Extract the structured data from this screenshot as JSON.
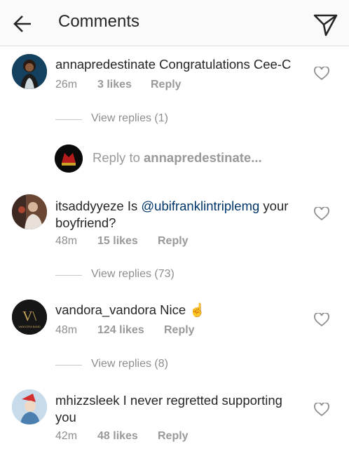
{
  "header": {
    "title": "Comments"
  },
  "comments": [
    {
      "username": "annapredestinate",
      "text": "Congratulations Cee-C",
      "time": "26m",
      "likes": "3 likes",
      "reply_label": "Reply",
      "view_replies": "View replies (1)"
    },
    {
      "username": "itsaddyyeze",
      "text_before": "Is ",
      "mention": "@ubifranklintriplemg",
      "text_after": " your boyfriend?",
      "time": "48m",
      "likes": "15 likes",
      "reply_label": "Reply",
      "view_replies": "View replies (73)"
    },
    {
      "username": "vandora_vandora",
      "text": "Nice",
      "emoji": "☝",
      "time": "48m",
      "likes": "124 likes",
      "reply_label": "Reply",
      "view_replies": "View replies (8)"
    },
    {
      "username": "mhizzsleek",
      "text": "I never regretted supporting you",
      "time": "42m",
      "likes": "48 likes",
      "reply_label": "Reply"
    }
  ],
  "reply_box": {
    "prefix": "Reply to ",
    "target": "annapredestinate..."
  },
  "avatars": {
    "vandora_logo": "V\\",
    "vandora_caption": "VANDORA BAND"
  },
  "colors": {
    "mention": "#003569",
    "secondary_text": "#8e8e8e",
    "emoji": "#d6336c"
  }
}
